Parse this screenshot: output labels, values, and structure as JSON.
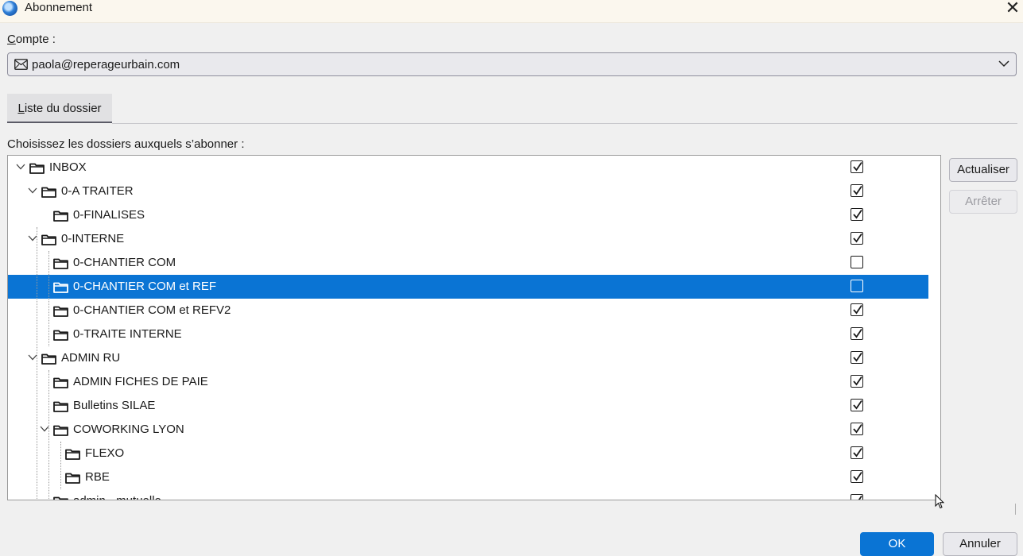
{
  "window": {
    "title": "Abonnement",
    "close_label": "✕"
  },
  "account": {
    "label": "Compte :",
    "value": "paola@reperageurbain.com"
  },
  "tabs": [
    {
      "label": "Liste du dossier"
    }
  ],
  "instruction": "Choisissez les dossiers auxquels s’abonner :",
  "folders": [
    {
      "name": "INBOX",
      "level": 0,
      "expanded": true,
      "checked": true
    },
    {
      "name": "0-A TRAITER",
      "level": 1,
      "expanded": true,
      "checked": true
    },
    {
      "name": "0-FINALISES",
      "level": 2,
      "checked": true
    },
    {
      "name": "0-INTERNE",
      "level": 1,
      "expanded": true,
      "checked": true
    },
    {
      "name": "0-CHANTIER COM",
      "level": 2,
      "checked": false
    },
    {
      "name": "0-CHANTIER COM et REF",
      "level": 2,
      "checked": false,
      "selected": true
    },
    {
      "name": "0-CHANTIER COM et REFV2",
      "level": 2,
      "checked": true
    },
    {
      "name": "0-TRAITE INTERNE",
      "level": 2,
      "checked": true
    },
    {
      "name": "ADMIN RU",
      "level": 1,
      "expanded": true,
      "checked": true
    },
    {
      "name": "ADMIN FICHES DE PAIE",
      "level": 2,
      "checked": true
    },
    {
      "name": "Bulletins SILAE",
      "level": 2,
      "checked": true
    },
    {
      "name": "COWORKING LYON",
      "level": 2,
      "expanded": true,
      "checked": true
    },
    {
      "name": "FLEXO",
      "level": 3,
      "checked": true
    },
    {
      "name": "RBE",
      "level": 3,
      "checked": true
    },
    {
      "name": "admin - mutuelle",
      "level": 2,
      "checked": true
    }
  ],
  "side_buttons": {
    "refresh": "Actualiser",
    "stop": "Arrêter"
  },
  "footer": {
    "ok": "OK",
    "cancel": "Annuler"
  },
  "colors": {
    "accent": "#0a74d4",
    "background": "#f0f0f0"
  },
  "icons": [
    "app-icon",
    "close-icon",
    "mail-account-icon",
    "chevron-down-icon",
    "folder-icon",
    "checkbox-check-icon"
  ]
}
